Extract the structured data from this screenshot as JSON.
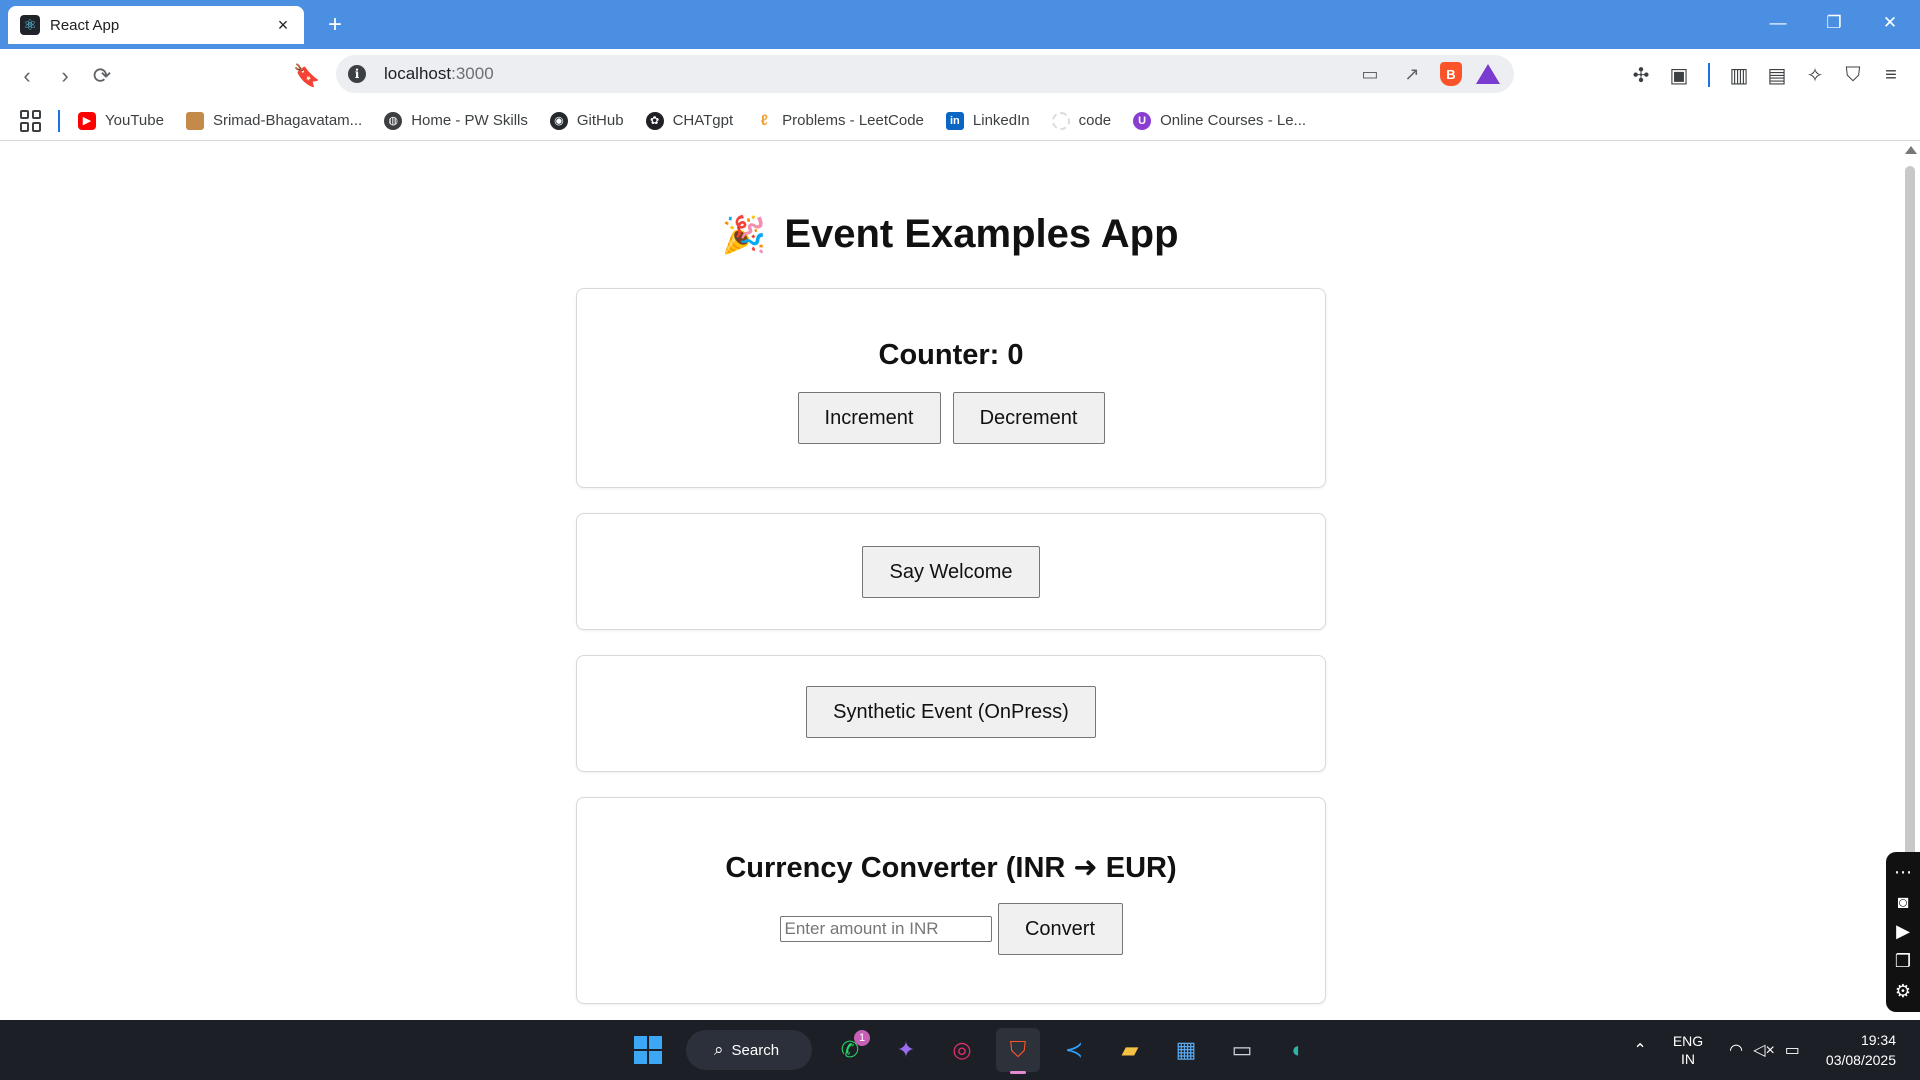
{
  "browser": {
    "tab_title": "React App",
    "tab_close": "×",
    "new_tab": "+",
    "url_host": "localhost",
    "url_port": ":3000",
    "window_controls": {
      "minimize": "—",
      "restore": "❐",
      "close": "✕"
    }
  },
  "bookmarks": [
    {
      "label": "YouTube",
      "icon": "youtube-icon",
      "color": "#ff0000"
    },
    {
      "label": "Srimad-Bhagavatam...",
      "icon": "bhagavatam-icon",
      "color": "#c48a4a"
    },
    {
      "label": "Home - PW Skills",
      "icon": "globe-icon",
      "color": "#3c4043"
    },
    {
      "label": "GitHub",
      "icon": "github-icon",
      "color": "#24292e"
    },
    {
      "label": "CHATgpt",
      "icon": "openai-icon",
      "color": "#202124"
    },
    {
      "label": "Problems - LeetCode",
      "icon": "leetcode-icon",
      "color": "#f2a33a"
    },
    {
      "label": "LinkedIn",
      "icon": "linkedin-icon",
      "color": "#0a66c2"
    },
    {
      "label": "code",
      "icon": "code-icon",
      "color": "#dcdcdc"
    },
    {
      "label": "Online Courses - Le...",
      "icon": "udemy-icon",
      "color": "#8a3ed1"
    }
  ],
  "app": {
    "title_emoji": "🎉",
    "title": "Event Examples App",
    "counter_label": "Counter: 0",
    "increment_label": "Increment",
    "decrement_label": "Decrement",
    "welcome_label": "Say Welcome",
    "synthetic_label": "Synthetic Event (OnPress)",
    "converter_title": "Currency Converter (INR ➜ EUR)",
    "converter_placeholder": "Enter amount in INR",
    "convert_label": "Convert"
  },
  "taskbar": {
    "search_label": "Search",
    "whatsapp_badge": "1",
    "lang_top": "ENG",
    "lang_bottom": "IN",
    "time": "19:34",
    "date": "03/08/2025"
  }
}
